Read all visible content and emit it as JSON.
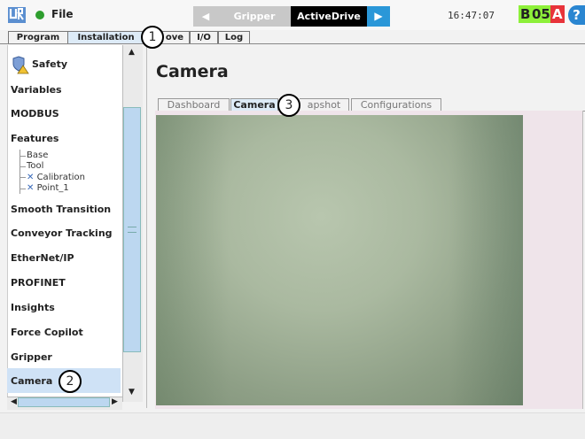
{
  "topbar": {
    "file_label": "File",
    "programs": [
      "Gripper",
      "ActiveDrive"
    ],
    "time": "16:47:07",
    "status": {
      "b": "B",
      "num": "05",
      "a": "A"
    },
    "help": "?"
  },
  "tabs": [
    "Program",
    "Installation",
    "ove",
    "I/O",
    "Log"
  ],
  "sidebar": {
    "items": [
      "Safety",
      "Variables",
      "MODBUS",
      "Features",
      "Smooth Transition",
      "Conveyor Tracking",
      "EtherNet/IP",
      "PROFINET",
      "Insights",
      "Force Copilot",
      "Gripper",
      "Camera"
    ],
    "feature_children": [
      "Base",
      "Tool",
      "Calibration",
      "Point_1"
    ],
    "selected": "Camera"
  },
  "main": {
    "title": "Camera",
    "subtabs": [
      "Dashboard",
      "Camera",
      "apshot",
      "Configurations"
    ],
    "active_subtab": "Camera"
  },
  "callouts": [
    "1",
    "2",
    "3"
  ],
  "colors": {
    "accent": "#2a97d8",
    "selected": "#cfe2f6",
    "status_green": "#8ef03a",
    "status_red": "#e8333a"
  },
  "icons": {
    "logo": "ur-logo-icon",
    "safety": "shield-icon",
    "feature_mark": "x-icon"
  }
}
